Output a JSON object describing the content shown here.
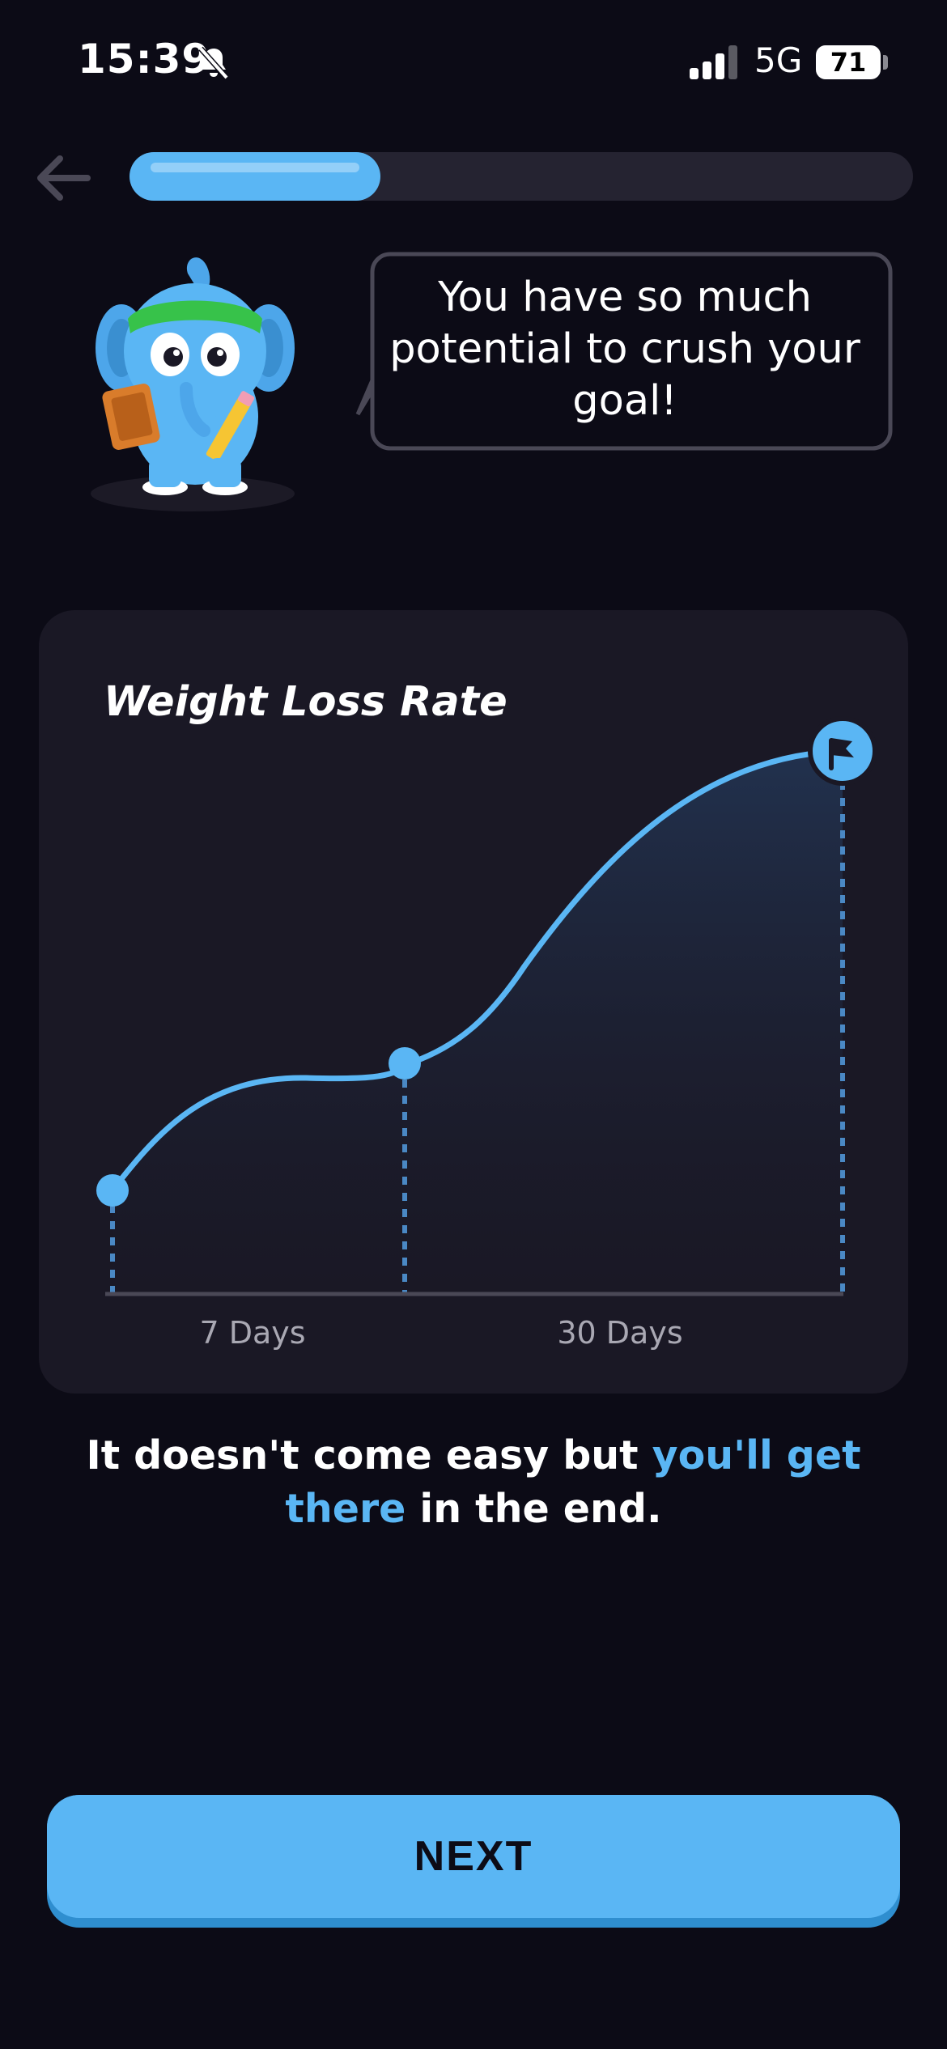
{
  "status_bar": {
    "time": "15:39",
    "network": "5G",
    "battery": "71",
    "icons": [
      "bell-slash-icon",
      "signal-bars-icon"
    ]
  },
  "nav": {
    "back_icon": "arrow-left-icon",
    "progress_fraction": 0.32
  },
  "mascot": {
    "icon": "elephant-mascot",
    "speech": "You have so much potential to crush your goal!"
  },
  "chart_data": {
    "type": "line",
    "title": "Weight Loss Rate",
    "x_ticks": [
      "7 Days",
      "30 Days"
    ],
    "markers": [
      "start",
      "7 Days",
      "goal"
    ],
    "end_icon": "flag-icon",
    "colors": {
      "line": "#5ab6f4",
      "card": "#1a1825",
      "axis": "#4a4856"
    },
    "grid": false
  },
  "caption": {
    "part1": "It doesn't come easy but ",
    "highlight": "you'll get there",
    "part2": " in the end.",
    "highlight_color": "#5ab6f4"
  },
  "next_button": {
    "label": "NEXT",
    "color": "#5ab6f4"
  }
}
